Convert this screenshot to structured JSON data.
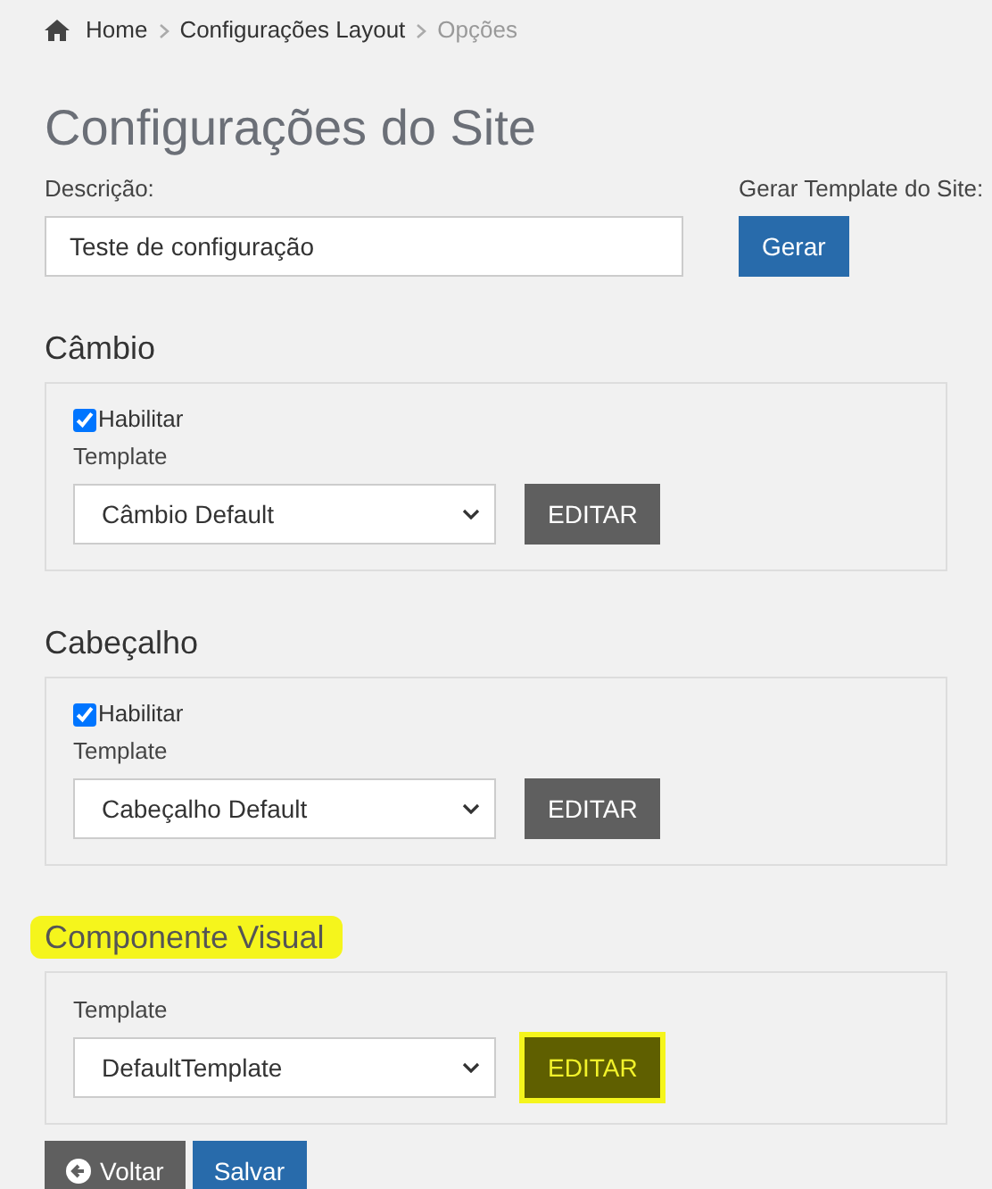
{
  "breadcrumb": [
    {
      "label": "Home",
      "kind": "home"
    },
    {
      "label": "Configurações Layout",
      "kind": "link"
    },
    {
      "label": "Opções",
      "kind": "current"
    }
  ],
  "title": "Configurações do Site",
  "description": {
    "label": "Descrição:",
    "value": "Teste de configuração"
  },
  "generate": {
    "label": "Gerar Template do Site:",
    "button": "Gerar"
  },
  "sections": [
    {
      "title": "Câmbio",
      "highlighted": false,
      "enable": {
        "label": "Habilitar",
        "checked": true
      },
      "template_label": "Template",
      "template": "Câmbio Default",
      "edit_button": "EDITAR",
      "edit_highlighted": false
    },
    {
      "title": "Cabeçalho",
      "highlighted": false,
      "enable": {
        "label": "Habilitar",
        "checked": true
      },
      "template_label": "Template",
      "template": "Cabeçalho Default",
      "edit_button": "EDITAR",
      "edit_highlighted": false
    },
    {
      "title": "Componente Visual",
      "highlighted": true,
      "template_label": "Template",
      "template": "DefaultTemplate",
      "edit_button": "EDITAR",
      "edit_highlighted": true
    }
  ],
  "actions": [
    {
      "label": "Voltar",
      "kind": "back"
    },
    {
      "label": "Salvar",
      "kind": "primary"
    }
  ]
}
